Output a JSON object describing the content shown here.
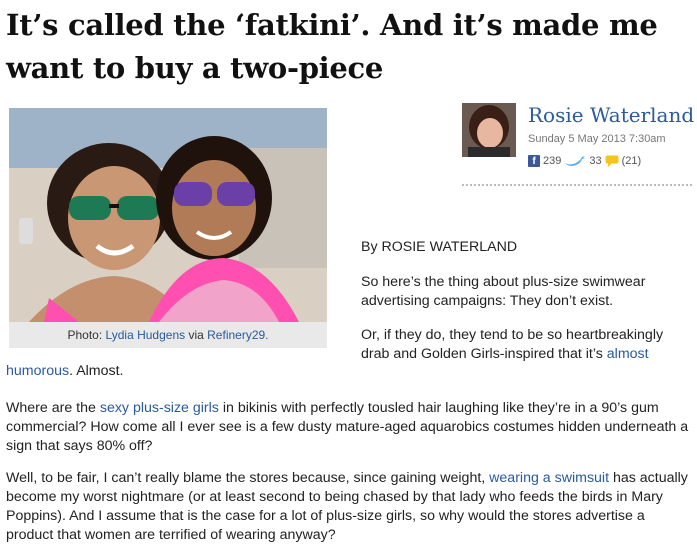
{
  "headline": "It’s called the ‘fatkini’. And it’s made me want to buy a two-piece",
  "photo": {
    "caption_prefix": "Photo: ",
    "caption_name": "Lydia Hudgens",
    "caption_via": " via ",
    "caption_source": "Refinery29."
  },
  "author": {
    "name": "Rosie Waterland",
    "date": "Sunday 5 May 2013 7:30am",
    "facebook_count": "239",
    "twitter_count": "33",
    "comments_count": "(21)"
  },
  "article": {
    "byline": "By ROSIE WATERLAND",
    "p1": "So here’s the thing about plus-size swimwear advertising campaigns: They don’t exist.",
    "p2_line1": "Or, if they do, they tend to be so heartbreakingly",
    "p2_line2_text": "drab and Golden Girls-inspired that it’s ",
    "p2_line2_link": "almost",
    "p2_line3_link": "humorous",
    "p2_line3_text": ". Almost.",
    "p3_before": "Where are the ",
    "p3_link": "sexy plus-size girls",
    "p3_after": " in bikinis with perfectly tousled hair laughing like they’re in a 90’s gum commercial? How come all I ever see is a few dusty mature-aged aquarobics costumes hidden underneath a sign that says 80% off?",
    "p4_before": "Well, to be fair, I can’t really blame the stores because, since gaining weight, ",
    "p4_link": "wearing a swimsuit",
    "p4_after": " has actually become my worst nightmare (or at least second to being chased by that lady who feeds the birds in Mary Poppins). And I assume that is the case for a lot of plus-size girls, so why would the stores advertise a product that women are terrified of wearing anyway?"
  },
  "colors": {
    "link": "#2a5a9c",
    "facebook": "#3b5998",
    "twitter": "#55acee",
    "comment": "#f5c518"
  },
  "icons": [
    "facebook-icon",
    "twitter-bird-icon",
    "comment-bubble-icon"
  ]
}
